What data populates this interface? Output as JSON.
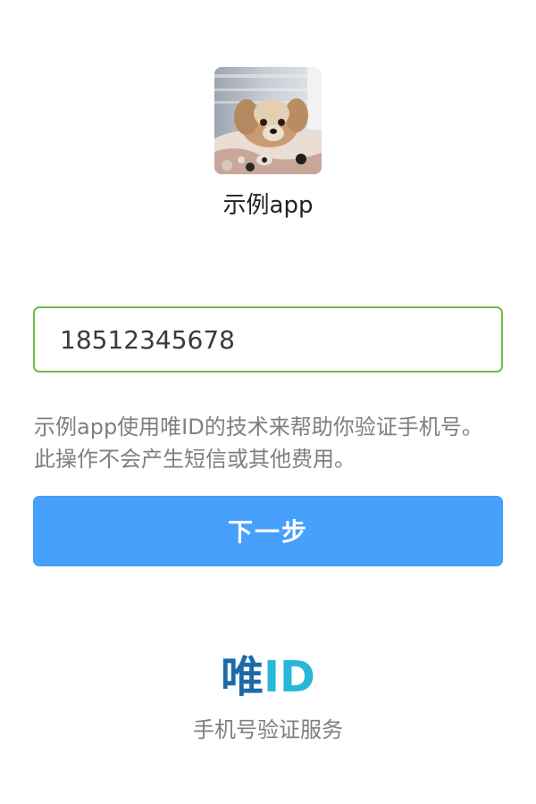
{
  "app": {
    "name": "示例app",
    "logo_icon": "dog-photo-icon"
  },
  "phone": {
    "value": "18512345678",
    "border_color": "#6cbf45"
  },
  "notice": {
    "text": "示例app使用唯ID的技术来帮助你验证手机号。此操作不会产生短信或其他费用。"
  },
  "next_button": {
    "label": "下一步",
    "color": "#46a0fc"
  },
  "brand": {
    "logo_part1": "唯",
    "logo_part2": "ID",
    "logo_color1": "#1e6aa7",
    "logo_color2": "#27b7d8",
    "tagline": "手机号验证服务"
  }
}
